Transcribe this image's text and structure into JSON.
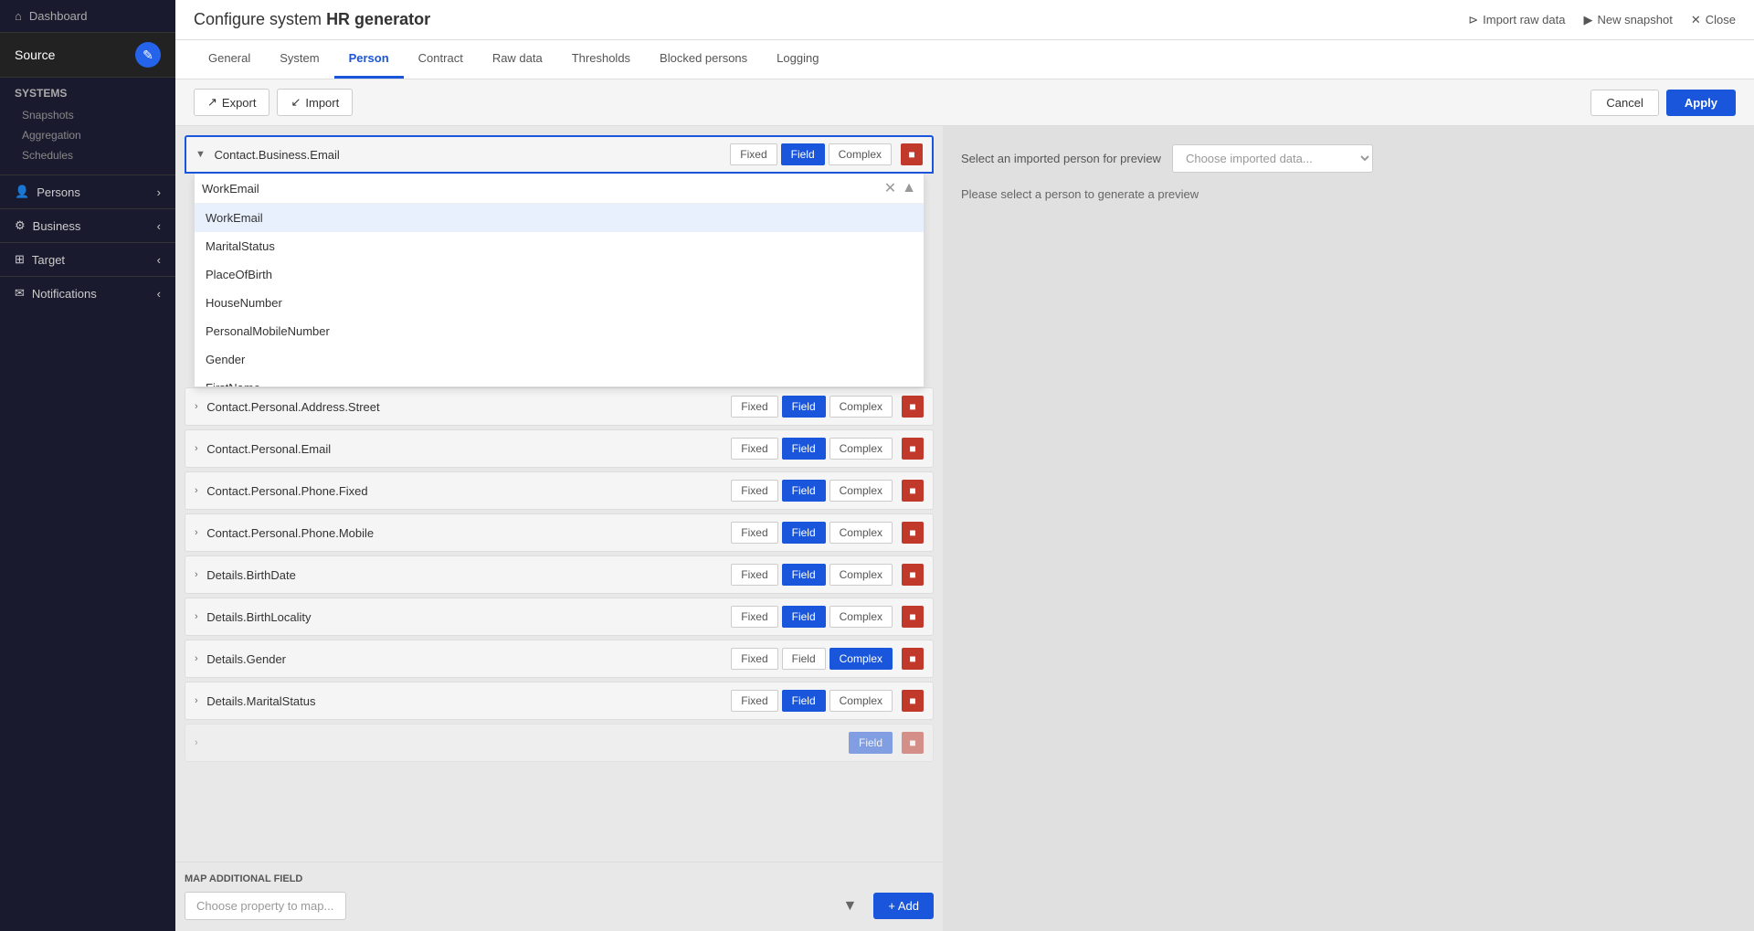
{
  "app": {
    "title": "Configure system ",
    "title_bold": "HR generator"
  },
  "header_actions": {
    "import_raw_data": "Import raw data",
    "new_snapshot": "New snapshot",
    "close": "Close"
  },
  "tabs": [
    {
      "id": "general",
      "label": "General",
      "active": false
    },
    {
      "id": "system",
      "label": "System",
      "active": false
    },
    {
      "id": "person",
      "label": "Person",
      "active": true
    },
    {
      "id": "contract",
      "label": "Contract",
      "active": false
    },
    {
      "id": "raw_data",
      "label": "Raw data",
      "active": false
    },
    {
      "id": "thresholds",
      "label": "Thresholds",
      "active": false
    },
    {
      "id": "blocked_persons",
      "label": "Blocked persons",
      "active": false
    },
    {
      "id": "logging",
      "label": "Logging",
      "active": false
    }
  ],
  "toolbar": {
    "export_label": "Export",
    "import_label": "Import",
    "cancel_label": "Cancel",
    "apply_label": "Apply"
  },
  "sidebar": {
    "dashboard_label": "Dashboard",
    "source_label": "Source",
    "systems_label": "Systems",
    "snapshots_label": "Snapshots",
    "aggregation_label": "Aggregation",
    "schedules_label": "Schedules",
    "persons_label": "Persons",
    "business_label": "Business",
    "target_label": "Target",
    "notifications_label": "Notifications"
  },
  "preview": {
    "label": "Select an imported person for preview",
    "placeholder": "Choose imported data...",
    "message": "Please select a person to generate a preview"
  },
  "dropdown": {
    "search_value": "WorkEmail",
    "items": [
      {
        "label": "WorkEmail",
        "selected": true
      },
      {
        "label": "MaritalStatus",
        "selected": false
      },
      {
        "label": "PlaceOfBirth",
        "selected": false
      },
      {
        "label": "HouseNumber",
        "selected": false
      },
      {
        "label": "PersonalMobileNumber",
        "selected": false
      },
      {
        "label": "Gender",
        "selected": false
      },
      {
        "label": "FirstName",
        "selected": false
      }
    ]
  },
  "mappings": [
    {
      "id": "contact-business-email",
      "label": "Contact.Business.Email",
      "expanded": true,
      "mode": "field",
      "show_delete": true
    },
    {
      "id": "contact-personal-address-street",
      "label": "Contact.Personal.Address.Street",
      "expanded": false,
      "mode": "field",
      "show_delete": true
    },
    {
      "id": "contact-personal-email",
      "label": "Contact.Personal.Email",
      "expanded": false,
      "mode": "field",
      "show_delete": true
    },
    {
      "id": "contact-personal-phone-fixed",
      "label": "Contact.Personal.Phone.Fixed",
      "expanded": false,
      "mode": "field",
      "show_delete": true
    },
    {
      "id": "contact-personal-phone-mobile",
      "label": "Contact.Personal.Phone.Mobile",
      "expanded": false,
      "mode": "field",
      "show_delete": true
    },
    {
      "id": "details-birthdate",
      "label": "Details.BirthDate",
      "expanded": false,
      "mode": "field",
      "show_delete": true
    },
    {
      "id": "details-birthlocality",
      "label": "Details.BirthLocality",
      "expanded": false,
      "mode": "field",
      "show_delete": true
    },
    {
      "id": "details-gender",
      "label": "Details.Gender",
      "expanded": false,
      "mode": "complex",
      "show_delete": true
    },
    {
      "id": "details-maritalstatus",
      "label": "Details.MaritalStatus",
      "expanded": false,
      "mode": "field",
      "show_delete": true
    }
  ],
  "add_field": {
    "label": "MAP ADDITIONAL FIELD",
    "placeholder": "Choose property to map...",
    "add_button": "+ Add"
  },
  "modes": {
    "fixed": "Fixed",
    "field": "Field",
    "complex": "Complex"
  }
}
